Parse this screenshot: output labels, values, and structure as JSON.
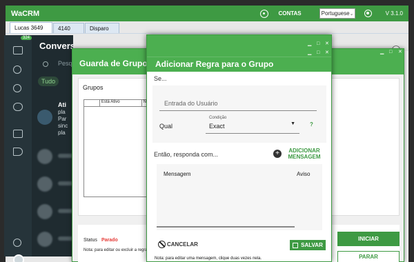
{
  "app": {
    "title": "WaCRM",
    "contas_label": "CONTAS",
    "language": "Portuguese",
    "version": "V 3.1.0"
  },
  "tabs": [
    "Lucas 3649",
    "4140",
    "Disparo"
  ],
  "sidebar": {
    "badge": "324"
  },
  "conversations": {
    "title": "Conversas",
    "search_placeholder": "Pesquisar",
    "filter_chip": "Tudo",
    "first_item_lines": [
      "Ati",
      "pla",
      "Par",
      "sinc",
      "pla"
    ]
  },
  "group_guard": {
    "title": "Guarda de Grupo - L",
    "grupos_label": "Grupos",
    "grid_columns": [
      "",
      "Está Ativo",
      "N"
    ],
    "status_label": "Status",
    "status_value": "Parado",
    "note": "Nota: para editar ou excluir a regra",
    "start_button": "INICIAR",
    "stop_button": "PARAR"
  },
  "rule_dialog": {
    "title": "Adicionar Regra para o Grupo",
    "if_label": "Se...",
    "user_input_placeholder": "Entrada do Usuário",
    "qual_label": "Qual",
    "condition_caption": "Condição",
    "condition_value": "Exact",
    "help": "?",
    "then_label": "Então, responda com...",
    "add_message": "ADICIONAR MENSAGEM",
    "col_message": "Mensagem",
    "col_aviso": "Aviso",
    "cancel": "CANCELAR",
    "save": "SALVAR",
    "note": "Nota: para editar uma mensagem, clique duas vezes nela."
  }
}
